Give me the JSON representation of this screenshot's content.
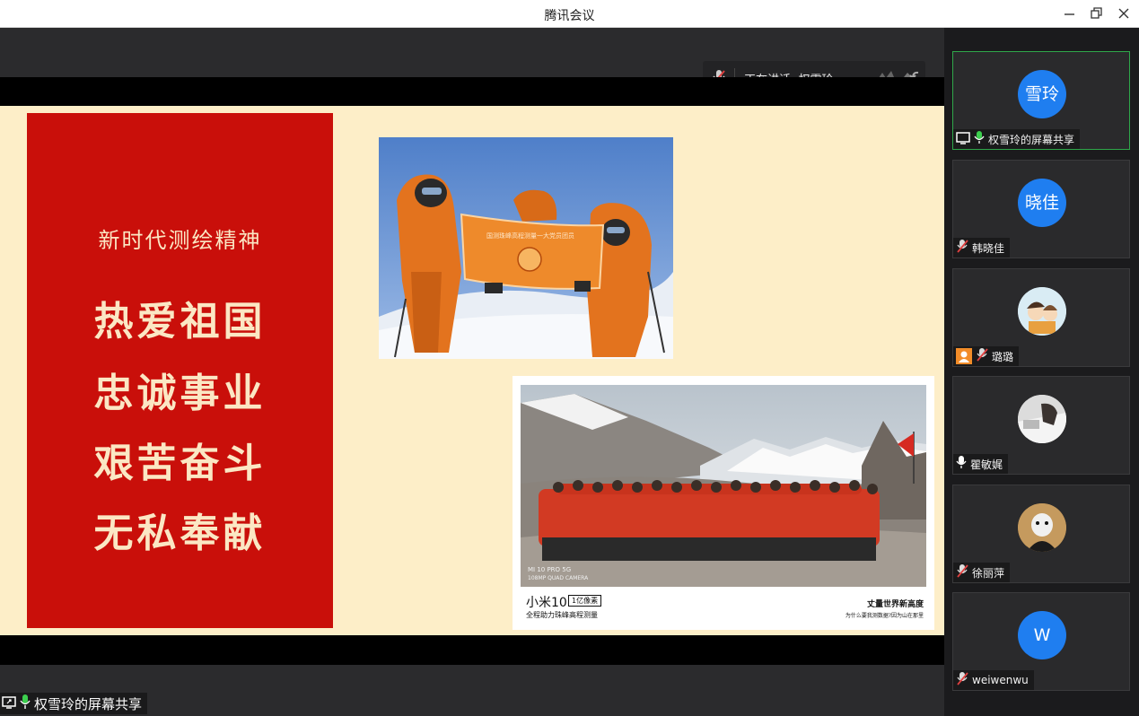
{
  "window": {
    "title": "腾讯会议"
  },
  "speaker": {
    "label": "正在讲话: 权雪玲;"
  },
  "slide": {
    "subtitle": "新时代测绘精神",
    "lines": [
      "热爱祖国",
      "忠诚事业",
      "艰苦奋斗",
      "无私奉献"
    ],
    "banner_text": "国测珠峰高程测量一大党员团员",
    "photo2": {
      "watermark_model": "MI 10 PRO 5G",
      "watermark_camera": "108MP QUAD CAMERA",
      "brand": "小米10",
      "brand_badge": "1亿像素",
      "caption_left": "全程助力珠峰高程测量",
      "caption_right_title": "丈量世界新高度",
      "caption_right_sub": "为什么要我测数据?因为山在那里"
    }
  },
  "participants": [
    {
      "name": "权雪玲的屏幕共享",
      "avatar_text": "雪玲",
      "avatar_type": "initials",
      "mic": "on",
      "screen_share": true,
      "active": true
    },
    {
      "name": "韩晓佳",
      "avatar_text": "晓佳",
      "avatar_type": "initials",
      "mic": "muted"
    },
    {
      "name": "璐璐",
      "avatar_type": "cartoon-photo",
      "mic": "muted",
      "host_badge": true
    },
    {
      "name": "瞿敏娓",
      "avatar_type": "photo",
      "mic": "on"
    },
    {
      "name": "徐丽萍",
      "avatar_type": "photo-dark",
      "mic": "muted"
    },
    {
      "name": "weiwenwu",
      "avatar_text": "W",
      "avatar_type": "initials",
      "mic": "muted"
    }
  ],
  "share_indicator": {
    "name": "权雪玲的屏幕共享"
  },
  "colors": {
    "avatar_blue": "#1f7ef0",
    "slide_red": "#c90f0a",
    "slide_cream": "#fdeec8",
    "active_border": "#2fa74a",
    "mic_green": "#3ccf4e"
  }
}
